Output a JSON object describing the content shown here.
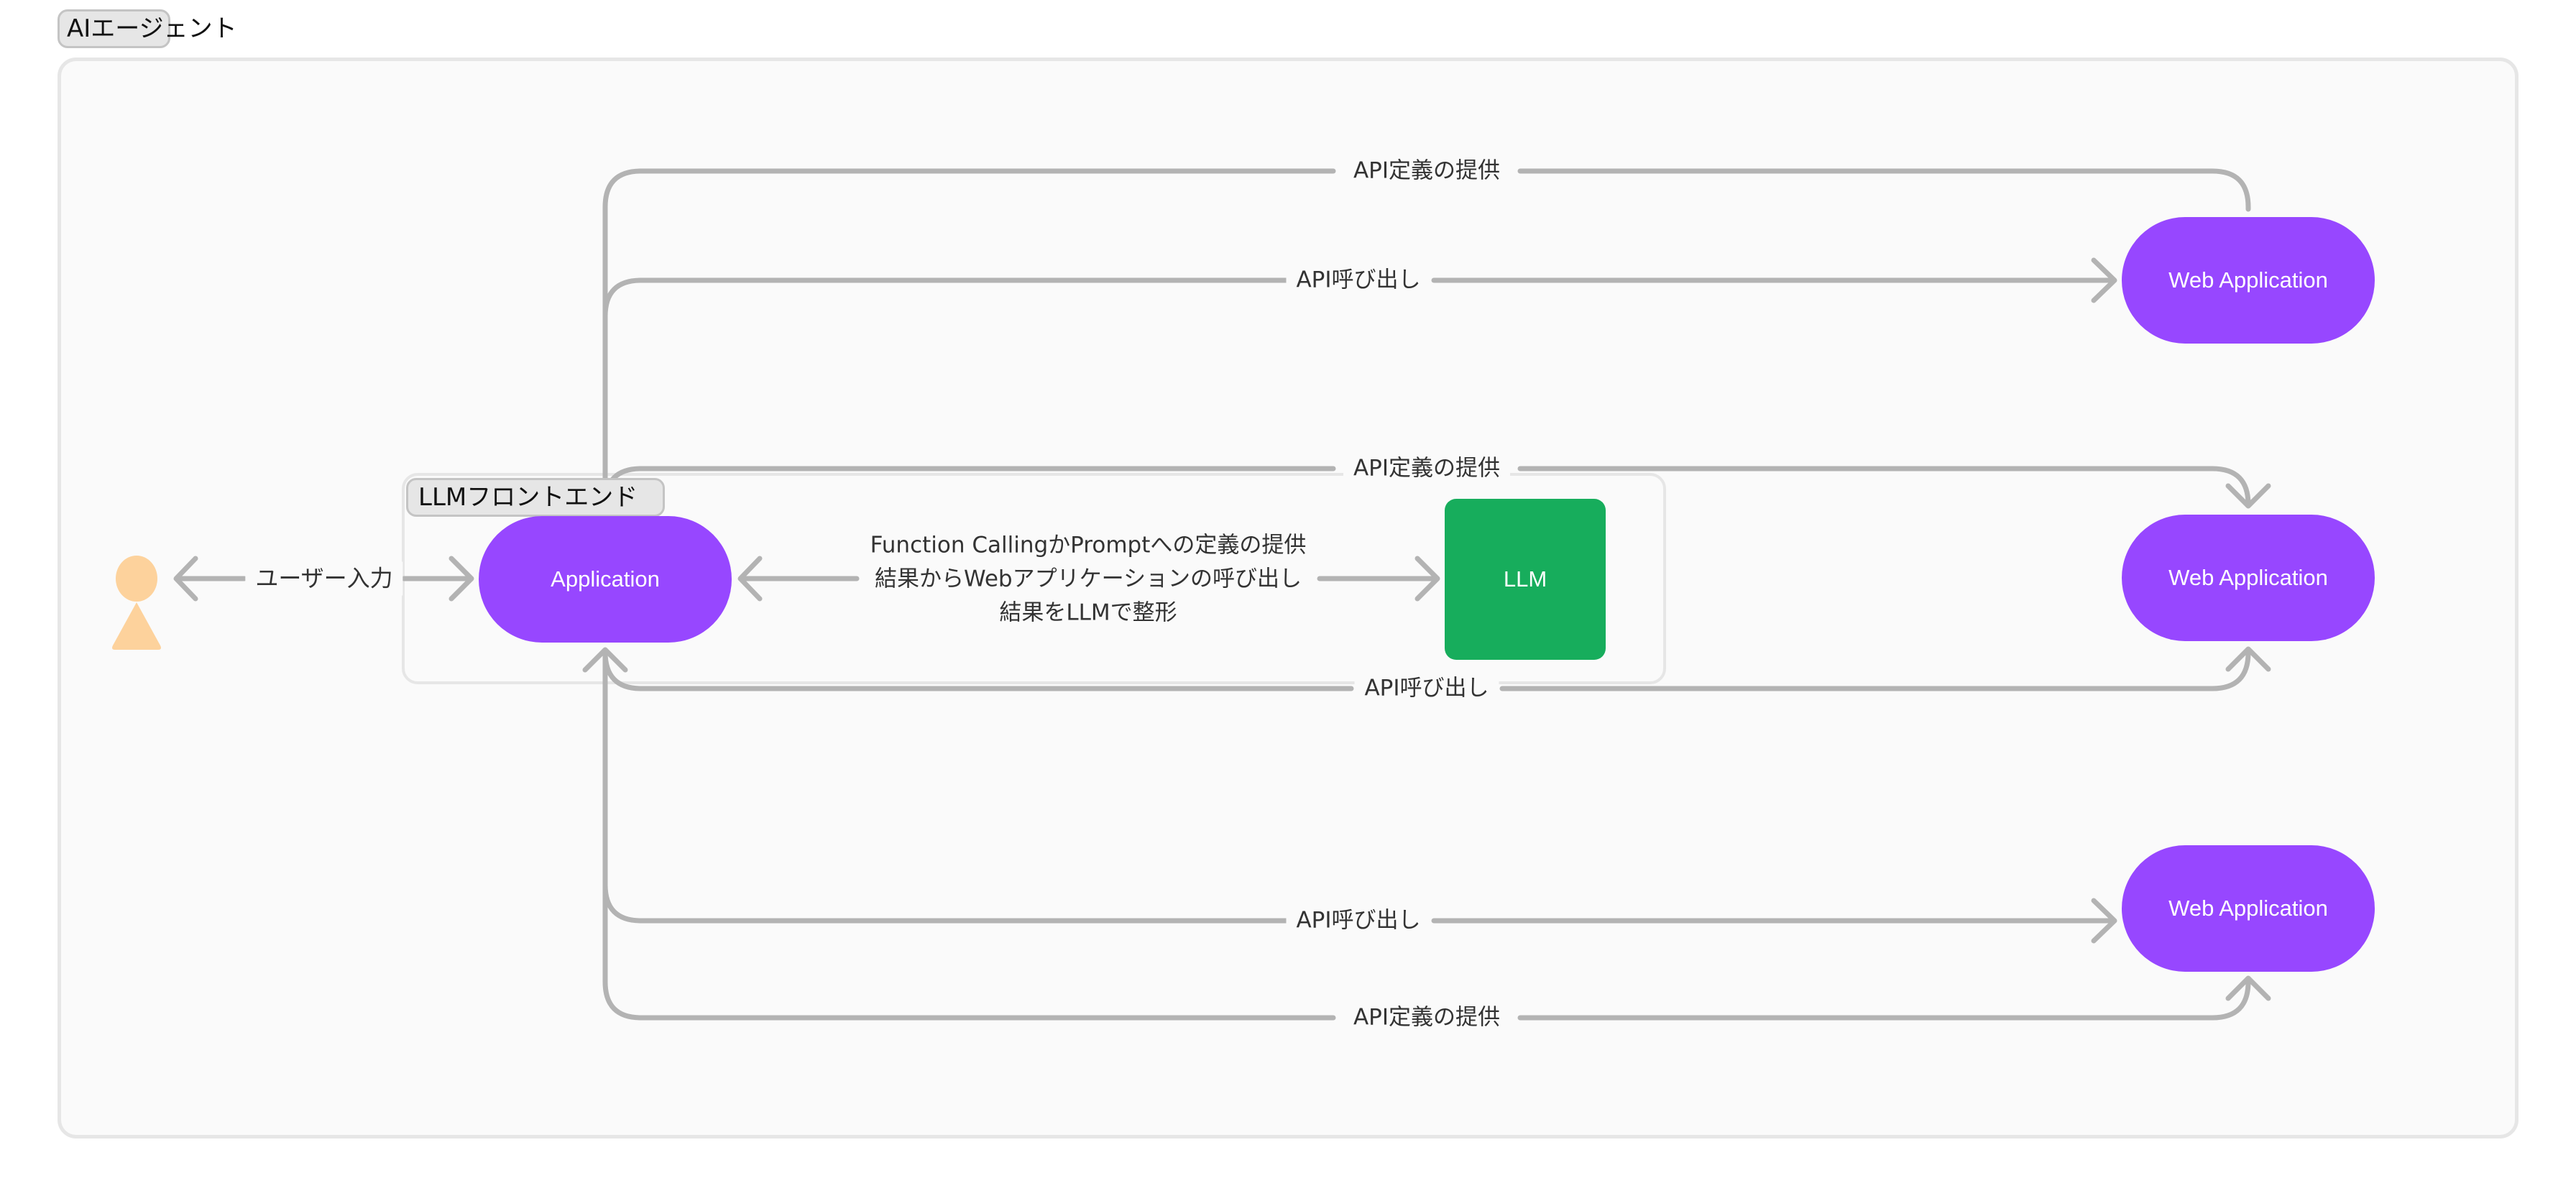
{
  "groups": {
    "outer": {
      "label": "AIエージェント"
    },
    "frontend": {
      "label": "LLMフロントエンド"
    }
  },
  "nodes": {
    "user": {
      "icon": "person-icon",
      "color": "#fdd29c"
    },
    "application": {
      "label": "Application",
      "color": "#9747ff"
    },
    "llm": {
      "label": "LLM",
      "color": "#17ad5c"
    },
    "web_app_1": {
      "label": "Web Application",
      "color": "#9747ff"
    },
    "web_app_2": {
      "label": "Web Application",
      "color": "#9747ff"
    },
    "web_app_3": {
      "label": "Web Application",
      "color": "#9747ff"
    }
  },
  "edges": {
    "user_input": {
      "label": "ユーザー入力",
      "from": "user",
      "to": "application",
      "direction": "both"
    },
    "app_llm": {
      "lines": [
        "Function CallingかPromptへの定義の提供",
        "結果からWebアプリケーションの呼び出し",
        "結果をLLMで整形"
      ],
      "from": "application",
      "to": "llm",
      "direction": "both"
    },
    "web1_api_def": {
      "label": "API定義の提供",
      "from": "web_app_1",
      "to": "application"
    },
    "web1_api_call": {
      "label": "API呼び出し",
      "from": "application",
      "to": "web_app_1"
    },
    "web2_api_def": {
      "label": "API定義の提供",
      "from": "application",
      "to": "web_app_2"
    },
    "web2_api_call": {
      "label": "API呼び出し",
      "from": "application",
      "to": "web_app_2",
      "direction": "both"
    },
    "web3_api_call": {
      "label": "API呼び出し",
      "from": "application",
      "to": "web_app_3"
    },
    "web3_api_def": {
      "label": "API定義の提供",
      "from": "application",
      "to": "web_app_3"
    }
  },
  "colors": {
    "edge": "#b3b3b3",
    "edge_label_text": "#333333",
    "container_fill": "#fafafa",
    "container_border": "#e6e6e6"
  }
}
